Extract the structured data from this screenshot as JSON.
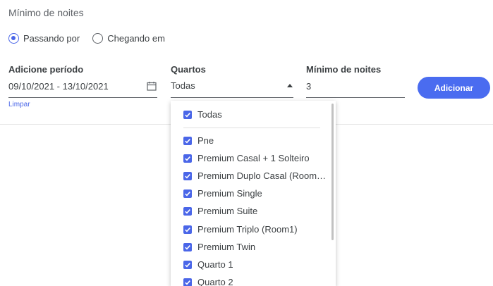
{
  "section_title": "Mínimo de noites",
  "radios": [
    {
      "label": "Passando por",
      "checked": true
    },
    {
      "label": "Chegando em",
      "checked": false
    }
  ],
  "period": {
    "label": "Adicione período",
    "value": "09/10/2021 - 13/10/2021",
    "clear_label": "Limpar"
  },
  "rooms": {
    "label": "Quartos",
    "value": "Todas"
  },
  "min_nights": {
    "label": "Mínimo de noites",
    "value": "3"
  },
  "add_button": "Adicionar",
  "dropdown": {
    "all_option": {
      "label": "Todas",
      "checked": true
    },
    "options": [
      {
        "label": "Pne",
        "checked": true
      },
      {
        "label": "Premium Casal + 1 Solteiro",
        "checked": true
      },
      {
        "label": "Premium Duplo Casal (Room…",
        "checked": true
      },
      {
        "label": "Premium Single",
        "checked": true
      },
      {
        "label": "Premium Suite",
        "checked": true
      },
      {
        "label": "Premium Triplo (Room1)",
        "checked": true
      },
      {
        "label": "Premium Twin",
        "checked": true
      },
      {
        "label": "Quarto 1",
        "checked": true
      },
      {
        "label": "Quarto 2",
        "checked": true
      }
    ]
  },
  "colors": {
    "accent": "#4a66e8",
    "button": "#4a6cf0"
  }
}
